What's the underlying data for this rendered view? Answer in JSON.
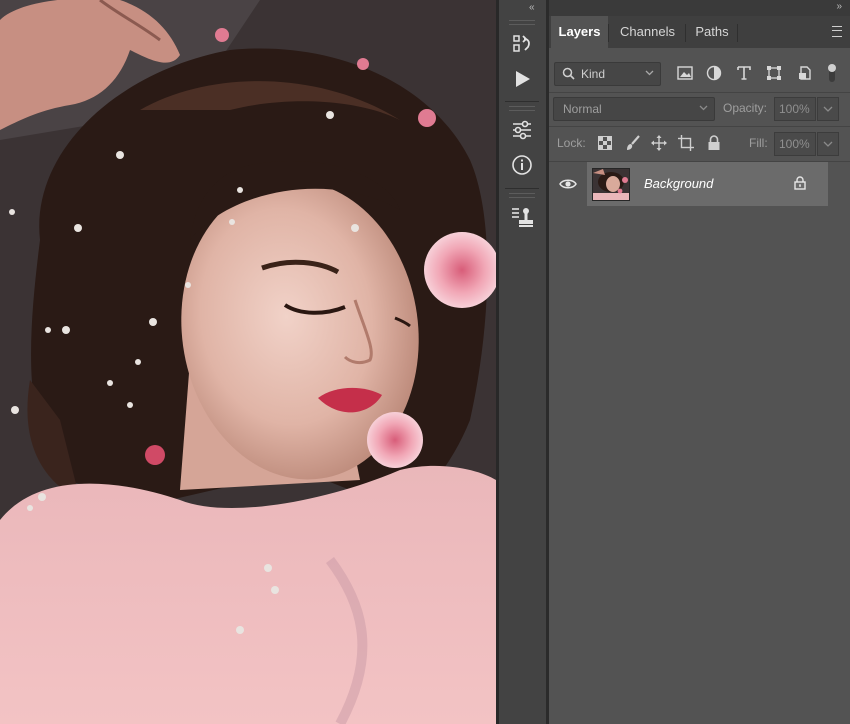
{
  "layers_panel": {
    "tabs": [
      {
        "label": "Layers",
        "active": true
      },
      {
        "label": "Channels",
        "active": false
      },
      {
        "label": "Paths",
        "active": false
      }
    ],
    "filter": {
      "kind_label": "Kind",
      "filter_icons": [
        "pixel-layer-filter-icon",
        "adjustment-filter-icon",
        "type-filter-icon",
        "shape-filter-icon",
        "smart-object-filter-icon"
      ]
    },
    "blend_mode": "Normal",
    "opacity_label": "Opacity:",
    "opacity_value": "100%",
    "lock_label": "Lock:",
    "fill_label": "Fill:",
    "fill_value": "100%",
    "layers": [
      {
        "name": "Background",
        "visible": true,
        "locked": true,
        "selected": true
      }
    ]
  },
  "colors": {
    "panel_bg": "#535353",
    "tab_bar_bg": "#3f3f3f",
    "selected_layer_bg": "#6b6b6b",
    "tool_strip_bg": "#434343"
  }
}
